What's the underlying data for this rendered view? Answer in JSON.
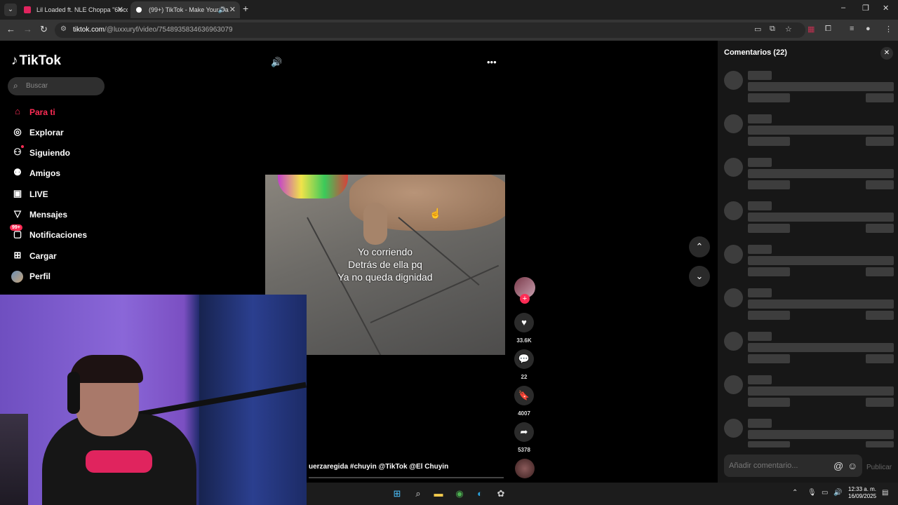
{
  "browser": {
    "tabs": [
      {
        "title": "Lil Loaded ft. NLE Choppa \"6locc",
        "close": "✕"
      },
      {
        "title": "(99+) TikTok - Make Your Da",
        "close": "✕"
      }
    ],
    "new_tab": "+",
    "url_host": "tiktok.com",
    "url_path": "/@luxxuryf/video/7548935834636963079"
  },
  "tiktok": {
    "logo": "TikTok",
    "search_placeholder": "Buscar",
    "nav": [
      {
        "label": "Para ti",
        "icon": "home-icon",
        "active": true
      },
      {
        "label": "Explorar",
        "icon": "compass-icon"
      },
      {
        "label": "Siguiendo",
        "icon": "following-icon"
      },
      {
        "label": "Amigos",
        "icon": "friends-icon"
      },
      {
        "label": "LIVE",
        "icon": "live-icon"
      },
      {
        "label": "Mensajes",
        "icon": "messages-icon"
      },
      {
        "label": "Notificaciones",
        "icon": "notifications-icon",
        "badge": "99+"
      },
      {
        "label": "Cargar",
        "icon": "upload-icon"
      },
      {
        "label": "Perfil",
        "icon": "profile-avatar"
      }
    ],
    "video": {
      "caption_lines": [
        "Yo corriendo",
        "Detrás de ella pq",
        "Ya no queda dignidad"
      ],
      "hashtags": "uerzaregida  #chuyin  @TikTok  @El Chuyin"
    },
    "actions": {
      "likes": "33.6K",
      "comments": "22",
      "saves": "4007",
      "shares": "5378"
    }
  },
  "comments_panel": {
    "title": "Comentarios (22)",
    "input_placeholder": "Añadir comentario...",
    "post_label": "Publicar"
  },
  "taskbar": {
    "time": "12:33 a. m.",
    "date": "16/09/2025"
  },
  "colors": {
    "accent": "#fe2c55",
    "panel_bg": "#171717",
    "skeleton": "#3d3d3d"
  }
}
